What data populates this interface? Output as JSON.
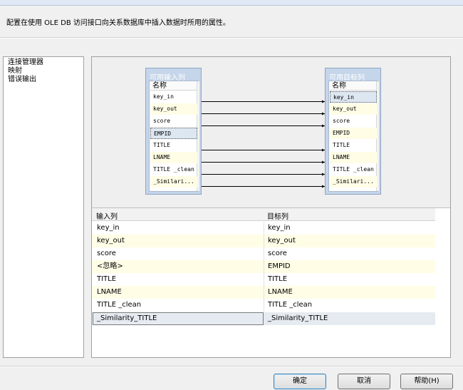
{
  "description": "配置在使用 OLE DB 访问接口向关系数据库中插入数据时所用的属性。",
  "nav": {
    "items": [
      "连接管理器",
      "映射",
      "错误输出"
    ]
  },
  "input_panel": {
    "title": "可用输入列",
    "header": "名称",
    "columns": [
      "key_in",
      "key_out",
      "score",
      "EMPID",
      "TITLE",
      "LNAME",
      "TITLE _clean",
      "_Similari..."
    ]
  },
  "dest_panel": {
    "title": "可用目标列",
    "header": "名称",
    "columns": [
      "key_in",
      "key_out",
      "score",
      "EMPID",
      "TITLE",
      "LNAME",
      "TITLE _clean",
      "_Similari..."
    ]
  },
  "grid": {
    "headers": [
      "输入列",
      "目标列"
    ],
    "rows": [
      {
        "input": "key_in",
        "dest": "key_in"
      },
      {
        "input": "key_out",
        "dest": "key_out"
      },
      {
        "input": "score",
        "dest": "score"
      },
      {
        "input": "<忽略>",
        "dest": "EMPID"
      },
      {
        "input": "TITLE",
        "dest": "TITLE"
      },
      {
        "input": "LNAME",
        "dest": "LNAME"
      },
      {
        "input": "TITLE _clean",
        "dest": "TITLE _clean"
      },
      {
        "input": "_Similarity_TITLE",
        "dest": "_Similarity_TITLE"
      }
    ]
  },
  "buttons": {
    "ok": "确定",
    "cancel": "取消",
    "help": "帮助(H)"
  }
}
